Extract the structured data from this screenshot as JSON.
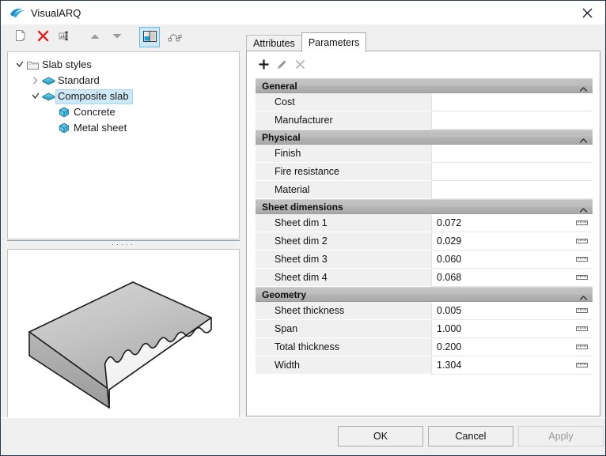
{
  "window": {
    "title": "VisualARQ",
    "logo_icon": "visualarq-logo-icon",
    "close_icon": "close-icon"
  },
  "toolbar": {
    "buttons": [
      {
        "name": "new-style-button",
        "icon": "new-document-icon",
        "active": false
      },
      {
        "name": "delete-style-button",
        "icon": "delete-x-icon",
        "active": false
      },
      {
        "name": "rename-style-button",
        "icon": "rename-text-icon",
        "active": false
      },
      {
        "name": "move-up-button",
        "icon": "arrow-up-icon",
        "active": false
      },
      {
        "name": "move-down-button",
        "icon": "arrow-down-icon",
        "active": false
      },
      {
        "name": "toggle-preview-button",
        "icon": "preview-pane-icon",
        "active": true
      },
      {
        "name": "profile-curve-button",
        "icon": "profile-curve-icon",
        "active": false
      }
    ]
  },
  "tree": {
    "items": [
      {
        "label": "Slab styles",
        "icon": "folder-icon",
        "level": 0,
        "twisty": "expanded",
        "selected": false
      },
      {
        "label": "Standard",
        "icon": "slab-style-icon",
        "level": 1,
        "twisty": "collapsed",
        "selected": false
      },
      {
        "label": "Composite slab",
        "icon": "slab-style-icon",
        "level": 1,
        "twisty": "expanded",
        "selected": true
      },
      {
        "label": "Concrete",
        "icon": "layer-cube-icon",
        "level": 2,
        "twisty": "none",
        "selected": false
      },
      {
        "label": "Metal sheet",
        "icon": "layer-cube-icon",
        "level": 2,
        "twisty": "none",
        "selected": false
      }
    ]
  },
  "splitter": {
    "grip": "·····"
  },
  "preview": {
    "name": "style-3d-preview",
    "description": "composite slab 3d preview"
  },
  "tabs": [
    {
      "label": "Attributes",
      "active": false,
      "name": "tab-attributes"
    },
    {
      "label": "Parameters",
      "active": true,
      "name": "tab-parameters"
    }
  ],
  "param_toolbar": {
    "buttons": [
      {
        "name": "add-parameter-button",
        "icon": "plus-icon",
        "glyph": "+",
        "enabled": true
      },
      {
        "name": "edit-parameter-button",
        "icon": "pencil-icon",
        "glyph": "",
        "enabled": false
      },
      {
        "name": "delete-parameter-button",
        "icon": "close-x-icon",
        "glyph": "×",
        "enabled": false
      }
    ]
  },
  "sections": [
    {
      "title": "General",
      "collapse_icon": "chevron-up-icon",
      "value_column": "short",
      "rows": [
        {
          "name": "Cost",
          "value": "",
          "unit_icon": ""
        },
        {
          "name": "Manufacturer",
          "value": "",
          "unit_icon": ""
        }
      ]
    },
    {
      "title": "Physical",
      "collapse_icon": "chevron-up-icon",
      "value_column": "full",
      "rows": [
        {
          "name": "Finish",
          "value": "",
          "unit_icon": ""
        },
        {
          "name": "Fire resistance",
          "value": "",
          "unit_icon": ""
        },
        {
          "name": "Material",
          "value": "",
          "unit_icon": ""
        }
      ]
    },
    {
      "title": "Sheet dimensions",
      "collapse_icon": "chevron-up-icon",
      "value_column": "full",
      "rows": [
        {
          "name": "Sheet dim 1",
          "value": "0.072",
          "unit_icon": "ruler-icon"
        },
        {
          "name": "Sheet dim 2",
          "value": "0.029",
          "unit_icon": "ruler-icon"
        },
        {
          "name": "Sheet dim 3",
          "value": "0.060",
          "unit_icon": "ruler-icon"
        },
        {
          "name": "Sheet dim 4",
          "value": "0.068",
          "unit_icon": "ruler-icon"
        }
      ]
    },
    {
      "title": "Geometry",
      "collapse_icon": "chevron-up-icon",
      "value_column": "full",
      "rows": [
        {
          "name": "Sheet thickness",
          "value": "0.005",
          "unit_icon": "ruler-icon"
        },
        {
          "name": "Span",
          "value": "1.000",
          "unit_icon": "ruler-icon"
        },
        {
          "name": "Total thickness",
          "value": "0.200",
          "unit_icon": "ruler-icon"
        },
        {
          "name": "Width",
          "value": "1.304",
          "unit_icon": "ruler-icon"
        }
      ]
    }
  ],
  "buttons": {
    "ok": "OK",
    "cancel": "Cancel",
    "apply": "Apply",
    "apply_enabled": false
  },
  "colors": {
    "accent": "#1a9fd4",
    "selection": "#cfe8f7",
    "section_header": "#b5b5b5",
    "delete_red": "#d62b2b",
    "window_border": "#2a3a4a"
  }
}
